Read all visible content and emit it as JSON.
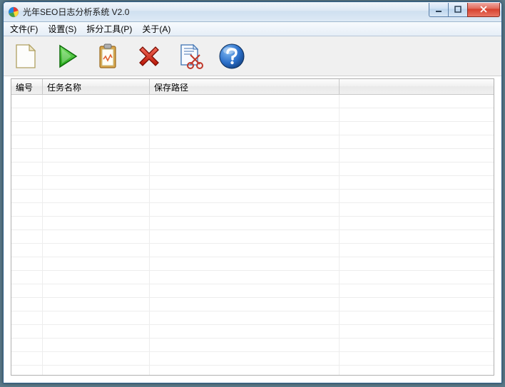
{
  "window": {
    "title": "光年SEO日志分析系统 V2.0"
  },
  "menu": {
    "file": "文件(F)",
    "settings": "设置(S)",
    "split_tools": "拆分工具(P)",
    "about": "关于(A)"
  },
  "toolbar": {
    "new": "new",
    "run": "run",
    "clipboard": "clipboard",
    "delete": "delete",
    "cut_tool": "cut-tool",
    "help": "help"
  },
  "grid": {
    "columns": {
      "id": "编号",
      "task_name": "任务名称",
      "save_path": "保存路径",
      "extra": ""
    },
    "rows": []
  }
}
